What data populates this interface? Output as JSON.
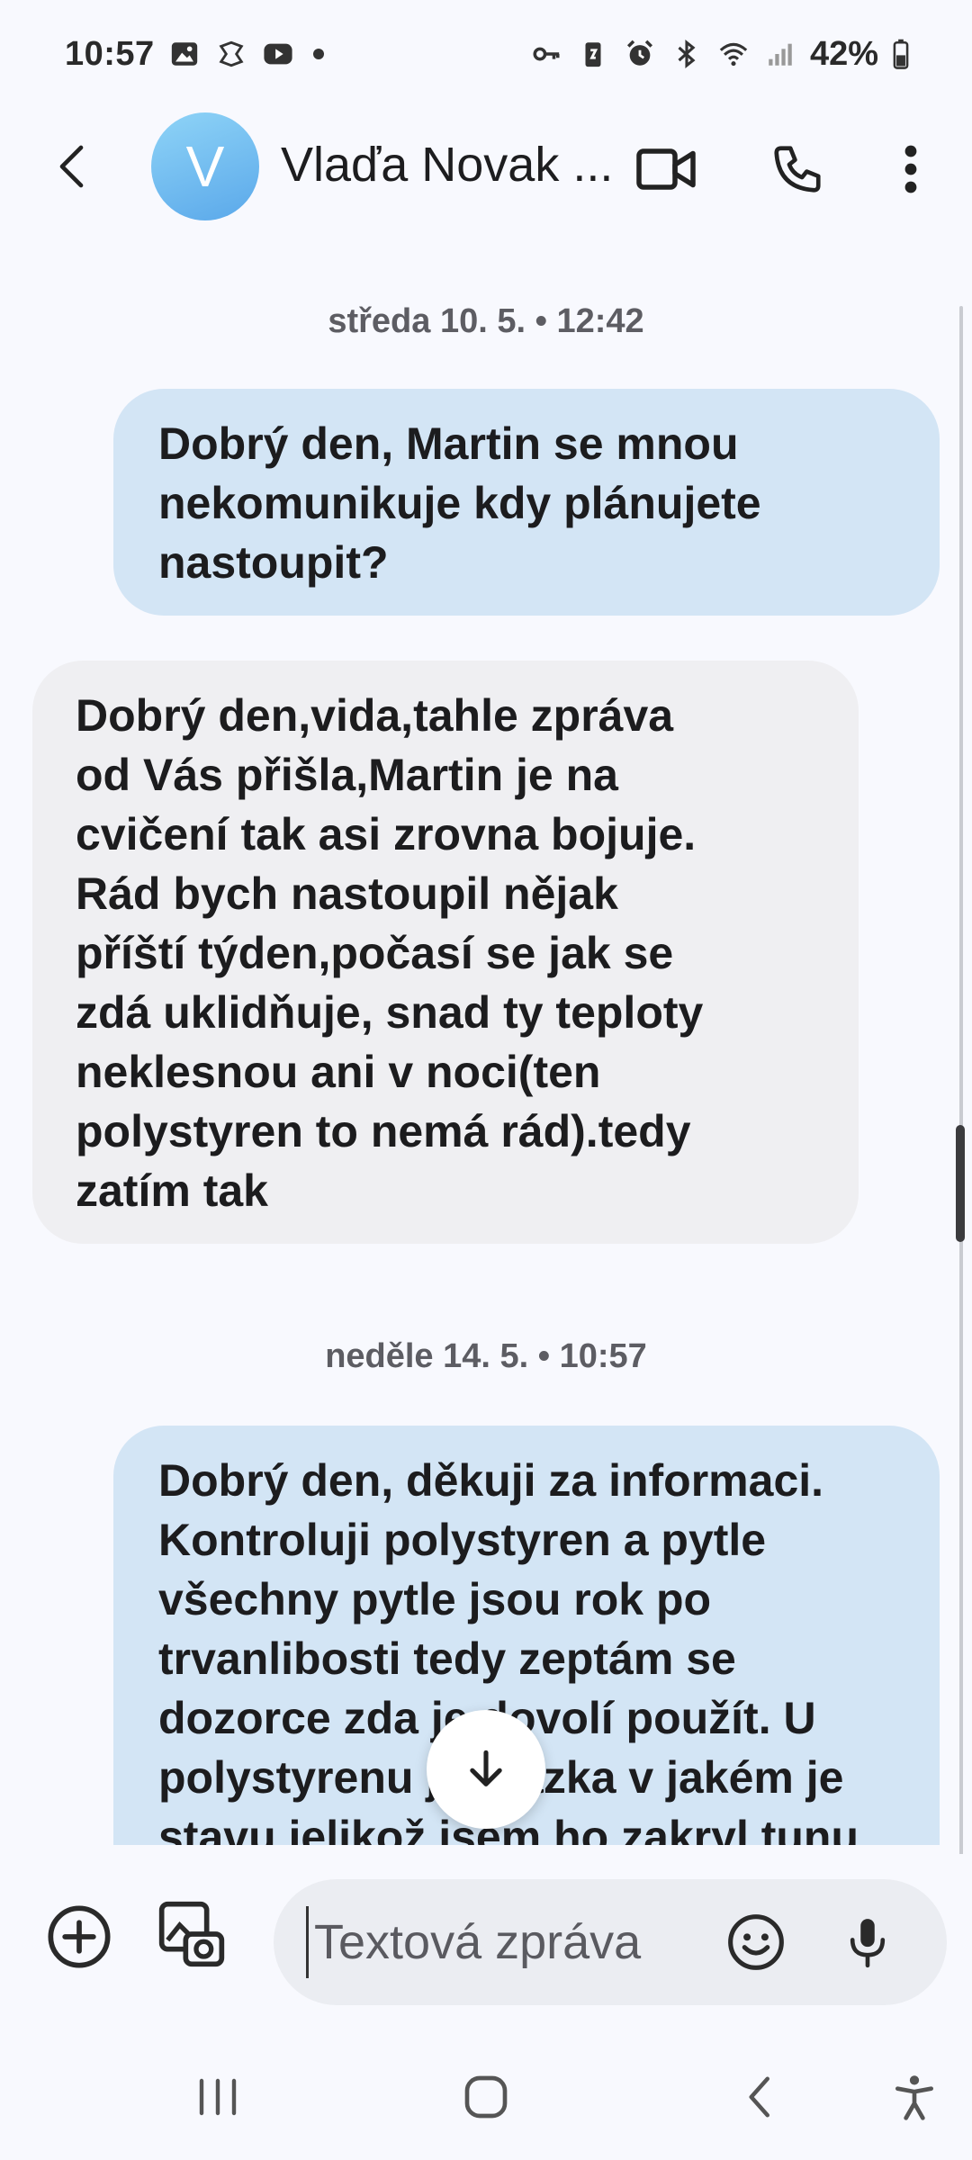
{
  "status_bar": {
    "time": "10:57",
    "battery": "42%",
    "left_icons": [
      "gallery-icon",
      "app-icon",
      "youtube-icon"
    ],
    "right_icons": [
      "key-icon",
      "battery-saver-icon",
      "alarm-icon",
      "bluetooth-icon",
      "wifi-icon",
      "signal-icon",
      "battery-icon"
    ]
  },
  "header": {
    "avatar_letter": "V",
    "contact_name": "Vlaďa Novak ...",
    "accent_avatar": "#6bbcf0"
  },
  "messages": [
    {
      "type": "date",
      "text": "středa 10. 5. • 12:42"
    },
    {
      "type": "sent",
      "text": "Dobrý den,  Martin se mnou nekomunikuje kdy plánujete nastoupit?"
    },
    {
      "type": "received",
      "text": "Dobrý den,vida,tahle zpráva od Vás přišla,Martin je na cvičení tak asi zrovna bojuje. Rád bych nastoupil nějak příští týden,počasí se jak se zdá uklidňuje, snad ty teploty neklesnou ani v noci(ten polystyren to nemá rád).tedy zatím tak"
    },
    {
      "type": "date",
      "text": "neděle 14. 5. • 10:57"
    },
    {
      "type": "sent",
      "text": "Dobrý den,  děkuji za informaci. Kontroluji polystyren a pytle všechny pytle jsou rok po trvanlibosti tedy zeptám se dozorce zda je dovolí použít. U polystyrenu je otázka v jakém je stavu  jelikož jsem ho zakryl tunu"
    }
  ],
  "input": {
    "placeholder": "Textová zpráva"
  },
  "colors": {
    "sent_bubble": "#d3e5f5",
    "received_bubble": "#efeff2",
    "background": "#f8f9fe"
  }
}
